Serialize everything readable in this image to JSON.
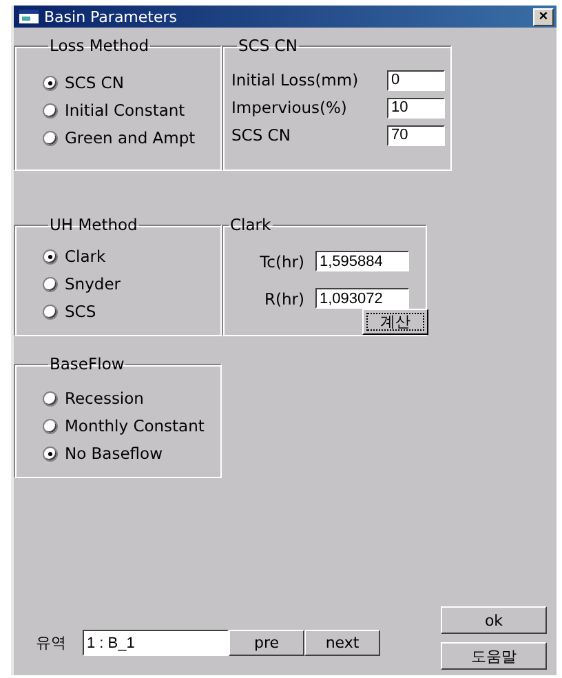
{
  "window": {
    "title": "Basin Parameters",
    "close": "×"
  },
  "loss_method": {
    "title": "Loss Method",
    "options": [
      {
        "label": "SCS CN",
        "selected": true
      },
      {
        "label": "Initial Constant",
        "selected": false
      },
      {
        "label": "Green and Ampt",
        "selected": false
      }
    ]
  },
  "scs_cn": {
    "title": "SCS CN",
    "fields": [
      {
        "label": "Initial Loss(mm)",
        "value": "0"
      },
      {
        "label": "Impervious(%)",
        "value": "10"
      },
      {
        "label": "SCS CN",
        "value": "70"
      }
    ]
  },
  "uh_method": {
    "title": "UH Method",
    "options": [
      {
        "label": "Clark",
        "selected": true
      },
      {
        "label": "Snyder",
        "selected": false
      },
      {
        "label": "SCS",
        "selected": false
      }
    ]
  },
  "clark": {
    "title": "Clark",
    "fields": [
      {
        "label": "Tc(hr)",
        "value": "1,595884"
      },
      {
        "label": "R(hr)",
        "value": "1,093072"
      }
    ],
    "button": "계산"
  },
  "baseflow": {
    "title": "BaseFlow",
    "options": [
      {
        "label": "Recession",
        "selected": false
      },
      {
        "label": "Monthly Constant",
        "selected": false
      },
      {
        "label": "No Baseflow",
        "selected": true
      }
    ]
  },
  "basin": {
    "label": "유역",
    "value": "1 : B_1",
    "buttons": [
      "pre",
      "next"
    ]
  },
  "buttons": [
    "ok",
    "도움말"
  ]
}
